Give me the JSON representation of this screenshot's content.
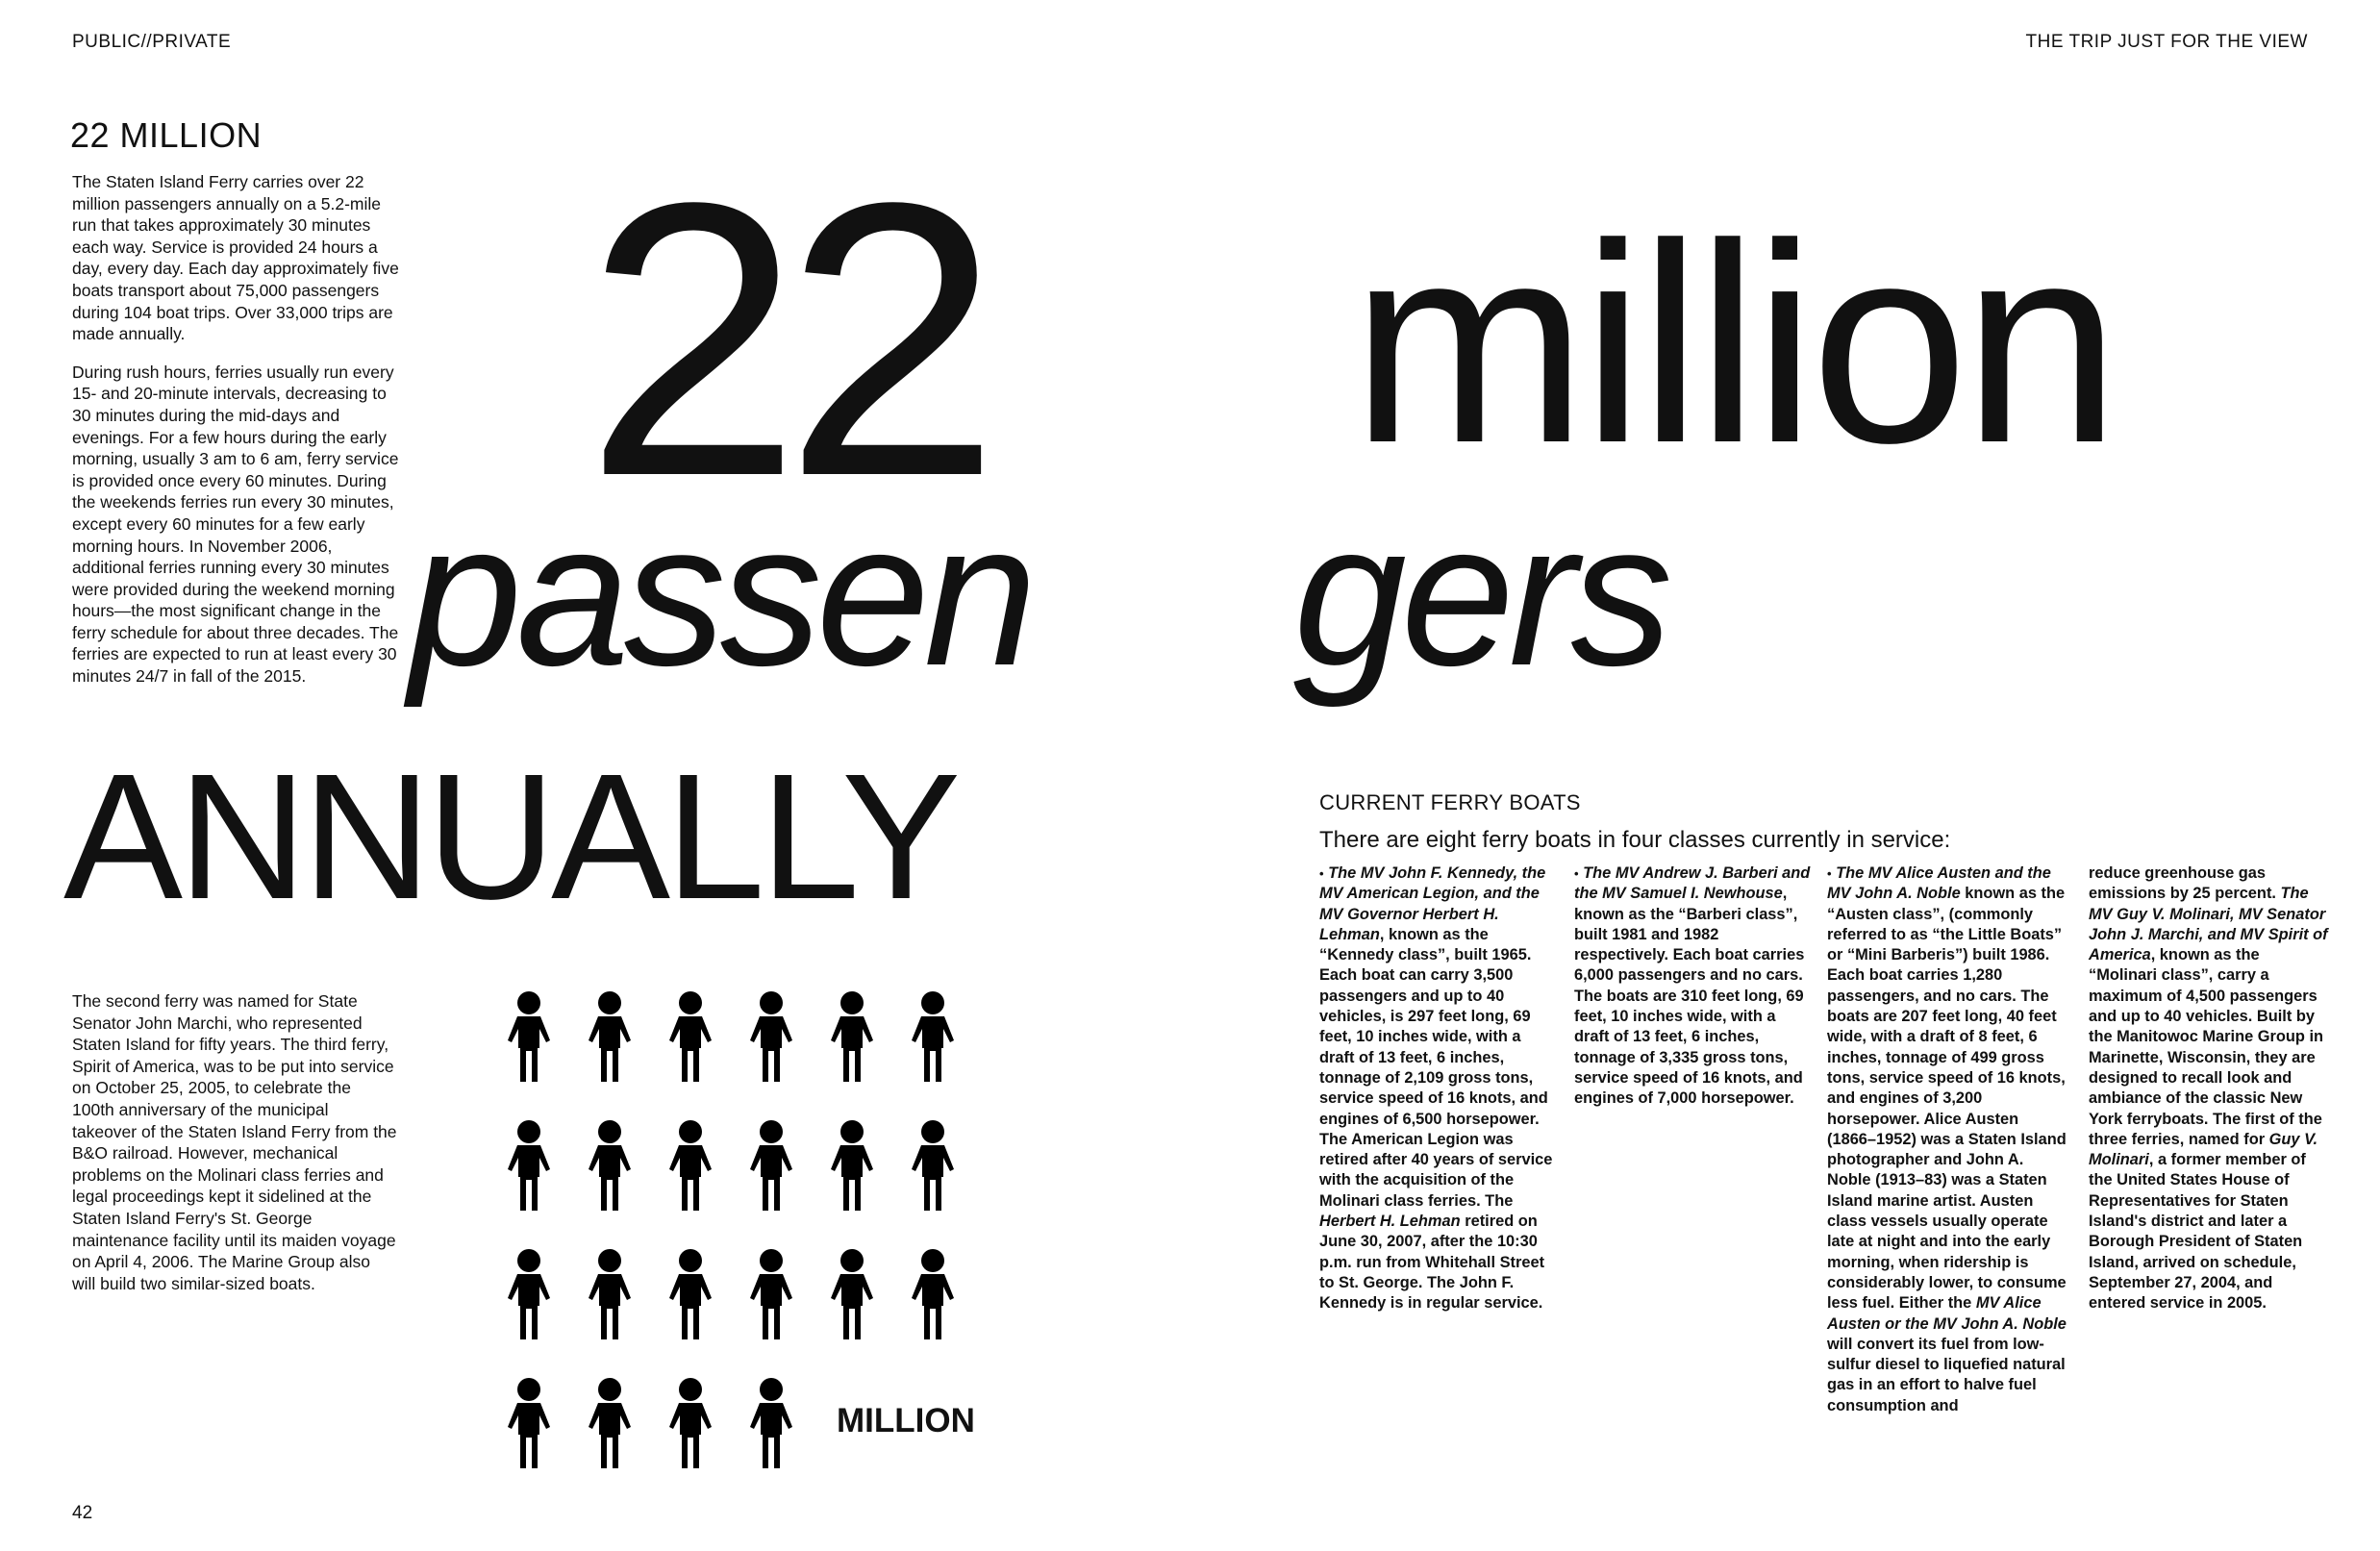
{
  "header": {
    "left": "PUBLIC//PRIVATE",
    "right": "THE TRIP JUST FOR THE VIEW"
  },
  "intro": {
    "title": "22 MILLION",
    "paragraphs": [
      "The Staten Island Ferry carries over 22 million passengers annually on a 5.2-mile run that takes approximately 30 minutes each way. Service is provided 24 hours a day, every day. Each day approximately five boats transport about 75,000 passengers during 104 boat trips. Over 33,000 trips are made annually.",
      "During rush hours, ferries usually run every 15- and 20-minute intervals, decreasing to 30 minutes during the mid-days and evenings. For a few hours during the early morning, usually 3 am to 6 am, ferry service is provided once every 60 minutes. During the weekends ferries run every 30 minutes, except every 60 minutes for a few early morning hours. In November 2006, additional ferries running every 30 minutes were provided during the weekend morning hours—the most significant change in the ferry schedule for about three decades. The ferries are expected to run at least every 30 minutes 24/7 in fall of the 2015."
    ]
  },
  "headline": {
    "number": "22",
    "unit": "million",
    "word_part1": "passen",
    "word_part2": "gers",
    "adverb": "ANNUALLY"
  },
  "second_ferry": {
    "text": "The second ferry was named for State Senator John Marchi, who represented Staten Island for fifty years. The third ferry, Spirit of America, was to be put into service on October 25, 2005, to celebrate the 100th anniversary of the municipal takeover of the Staten Island Ferry from the B&O railroad. However, mechanical problems on the Molinari class ferries and legal proceedings kept it sidelined at the Staten Island Ferry's St. George maintenance facility until its maiden voyage on April 4, 2006. The Marine Group also will build two similar-sized boats."
  },
  "pictogram": {
    "count": 22,
    "per_row": 6,
    "icon": "person-icon",
    "label": "MILLION"
  },
  "ferry_boats": {
    "title": "CURRENT FERRY BOATS",
    "subtitle": "There are eight ferry boats in four classes currently in service:"
  },
  "page_number": "42"
}
